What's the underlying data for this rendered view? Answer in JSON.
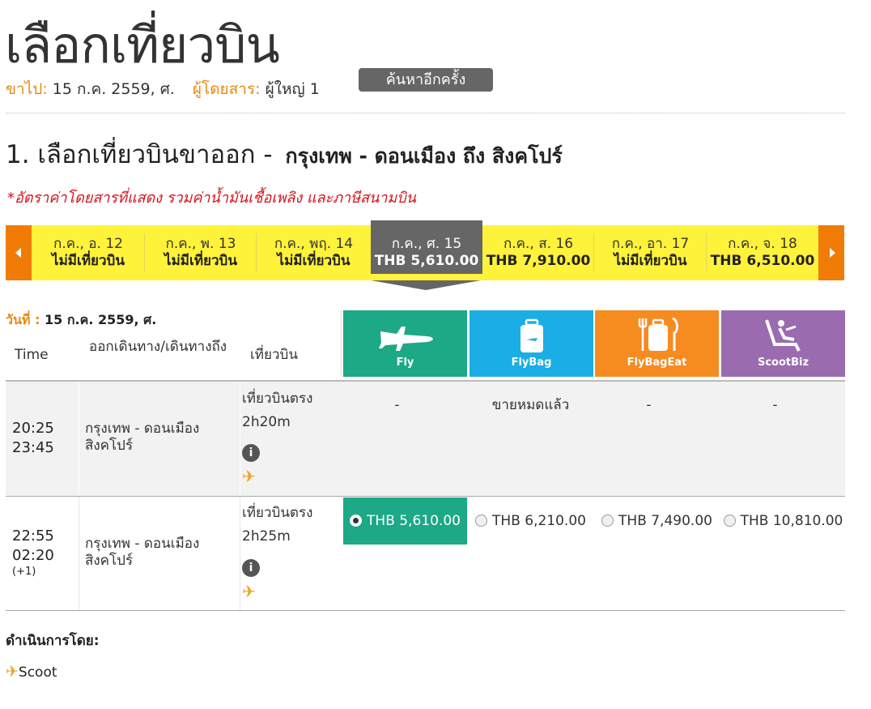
{
  "page": {
    "title": "เลือกเที่ยวบิน",
    "depart_label": "ขาไป:",
    "depart_value": "15 ก.ค. 2559, ศ.",
    "passenger_label": "ผู้โดยสาร:",
    "passenger_value": "ผู้ใหญ่ 1",
    "search_again": "ค้นหาอีกครั้ง"
  },
  "section": {
    "title": "1. เลือกเที่ยวบินขาออก -",
    "route": "กรุงเทพ - ดอนเมือง  ถึง  สิงคโปร์",
    "fare_note": "*อัตราค่าโดยสารที่แสดง รวมค่าน้ำมันเชื้อเพลิง และภาษีสนามบิน"
  },
  "date_strip": {
    "selected_index": 3,
    "dates": [
      {
        "date": "ก.ค., อ. 12",
        "price": "ไม่มีเที่ยวบิน"
      },
      {
        "date": "ก.ค., พ. 13",
        "price": "ไม่มีเที่ยวบิน"
      },
      {
        "date": "ก.ค., พฤ. 14",
        "price": "ไม่มีเที่ยวบิน"
      },
      {
        "date": "ก.ค., ศ. 15",
        "price": "THB 5,610.00"
      },
      {
        "date": "ก.ค., ส. 16",
        "price": "THB 7,910.00"
      },
      {
        "date": "ก.ค., อา. 17",
        "price": "ไม่มีเที่ยวบิน"
      },
      {
        "date": "ก.ค., จ. 18",
        "price": "THB 6,510.00"
      }
    ]
  },
  "table": {
    "date_label": "วันที่ :",
    "date_value": "15 ก.ค. 2559, ศ.",
    "col_time": "Time",
    "col_route": "ออกเดินทาง/เดินทางถึง",
    "col_flight": "เที่ยวบิน",
    "fares": [
      {
        "name": "Fly",
        "color": "#1da886",
        "icon": "plane-icon"
      },
      {
        "name": "FlyBag",
        "color": "#1aaee5",
        "icon": "luggage-icon"
      },
      {
        "name": "FlyBagEat",
        "color": "#f68b1f",
        "icon": "luggage-meal-icon"
      },
      {
        "name": "ScootBiz",
        "color": "#9b6bb0",
        "icon": "recliner-seat-icon"
      }
    ],
    "rows": [
      {
        "depart": "20:25",
        "arrive": "23:45",
        "next_day": "",
        "origin": "กรุงเทพ - ดอนเมือง",
        "destination": "สิงคโปร์",
        "flight_type": "เที่ยวบินตรง",
        "duration": "2h20m",
        "info": "i",
        "prices": [
          "-",
          "ขายหมดแล้ว",
          "-",
          "-"
        ]
      },
      {
        "depart": "22:55",
        "arrive": "02:20",
        "next_day": "(+1)",
        "origin": "กรุงเทพ - ดอนเมือง",
        "destination": "สิงคโปร์",
        "flight_type": "เที่ยวบินตรง",
        "duration": "2h25m",
        "info": "i",
        "prices": [
          "THB 5,610.00",
          "THB 6,210.00",
          "THB 7,490.00",
          "THB 10,810.00"
        ],
        "selected_fare": 0
      }
    ]
  },
  "footer": {
    "operated_by": "ดำเนินการโดย:",
    "operator": "Scoot"
  }
}
